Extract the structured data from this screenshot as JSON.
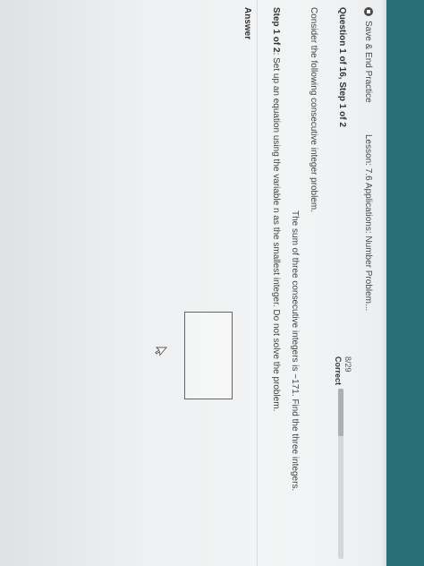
{
  "app": {
    "save_end_label": "Save & End Practice",
    "lesson_label": "Lesson: 7.6 Applications: Number Problem..."
  },
  "question": {
    "header": "Question 1 of 16,  Step 1 of 2",
    "intro": "Consider the following consecutive integer problem.",
    "problem": "The sum of three consecutive integers is −171. Find the three integers.",
    "step_label": "Step 1 of 2",
    "step_text": ": Set up an equation using the variable n as the smallest integer. Do not solve the problem."
  },
  "progress": {
    "count": "8/29",
    "status": "Correct",
    "fraction": 0.28
  },
  "answer": {
    "label": "Answer",
    "value": ""
  },
  "colors": {
    "topbar": "#2a6f78"
  },
  "icons": {
    "save_end": "stop-circle-icon",
    "cursor": "mouse-pointer-icon"
  }
}
